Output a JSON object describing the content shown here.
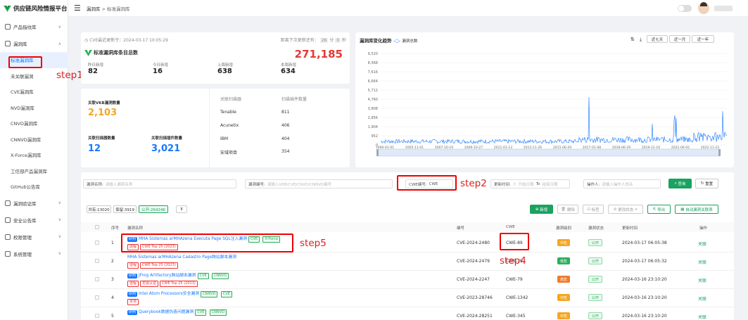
{
  "app": {
    "title": "供应链风险情报平台"
  },
  "breadcrumb": {
    "parent": "漏洞库",
    "sep": ">",
    "current": "标准漏洞库"
  },
  "sidebar": {
    "items": [
      {
        "label": "产品指纹库"
      },
      {
        "label": "漏洞库"
      },
      {
        "label": "漏洞验证库"
      },
      {
        "label": "安全公告库"
      },
      {
        "label": "权限管理"
      },
      {
        "label": "系统管理"
      }
    ],
    "sub": [
      "标准漏洞库",
      "未关联漏洞",
      "CVE漏洞库",
      "NVD漏洞库",
      "CNVD漏洞库",
      "CNNVD漏洞库",
      "X-Force漏洞库",
      "工信部产品漏洞库",
      "GitHub公告库"
    ]
  },
  "summary": {
    "update_label": "CVE最近更新于：",
    "update_time": "2024-03-17 10:05:29",
    "next_label": "距离下次更新还有：",
    "next_h": "26",
    "next_h_unit": "分",
    "next_m": "0",
    "next_m_unit": "秒",
    "title": "标准漏洞库条目总数",
    "total": "271,185",
    "stats": [
      {
        "label": "昨日新增",
        "value": "82"
      },
      {
        "label": "今日新增",
        "value": "16"
      },
      {
        "label": "上周新增",
        "value": "638"
      },
      {
        "label": "本周新增",
        "value": "634"
      }
    ]
  },
  "assoc": {
    "vkb_label": "关联VKB漏洞数量",
    "vkb_value": "2,103",
    "scan_label": "关联扫描器数量",
    "scan_value": "12",
    "plugin_label": "关联扫描插件数量",
    "plugin_value": "3,021",
    "col1": "关联扫描器",
    "col2": "扫描插件数量",
    "rows": [
      {
        "name": "Tenable",
        "count": "811"
      },
      {
        "name": "Acunetix",
        "count": "406"
      },
      {
        "name": "IBM",
        "count": "404"
      },
      {
        "name": "安域项目",
        "count": "354"
      }
    ]
  },
  "trend": {
    "title": "漏洞库变化趋势",
    "legend": "漏洞总数",
    "ranges": [
      "近七天",
      "近一月",
      "近一年"
    ],
    "yticks": [
      "9,520",
      "8,568",
      "7,616",
      "6,664",
      "5,712",
      "4,760",
      "3,808",
      "2,856",
      "1,904",
      "952",
      "0"
    ],
    "xticks": [
      "1900-01-01",
      "2005-11-01",
      "2007-10-19",
      "2009-10-27",
      "2011-01-13",
      "2013-11-26",
      "2015-06-29",
      "2017-01-08",
      "2018-06-29",
      "2019-12-16",
      "2021-06-02",
      "2022-11-23"
    ]
  },
  "filters": {
    "name_label": "漏洞名称:",
    "name_ph": "请输入漏洞名称",
    "id_label": "漏洞编号:",
    "id_ph": "请输入VKB/CVE/CNVD/CNNVD编号",
    "cwe_label": "CWE编号:",
    "cwe_value": "CWE",
    "time_label": "更新时间:",
    "time_start": "开始日期",
    "time_to": "To",
    "time_end": "结束日期",
    "op_label": "操作人:",
    "op_ph": "请输入操作人姓名",
    "search": "查询",
    "reset": "重置"
  },
  "counts": {
    "all": "共有:13020",
    "keep": "保留:3919",
    "public": "公开:264246"
  },
  "actions": {
    "add": "新增",
    "delete": "删除",
    "tag": "标签",
    "status": "更改状态",
    "export": "导出",
    "batch": "自动漏洞关联表"
  },
  "table": {
    "headers": [
      "序号",
      "漏洞名称",
      "编号",
      "CWE",
      "漏洞级别",
      "漏洞状态",
      "更新时间",
      "操作"
    ],
    "rows": [
      {
        "no": "1",
        "research": "研判",
        "name": "MHA Sistemas arMHAzena Executa Page SQL注入漏洞",
        "src": [
          "CVE",
          "X-Force"
        ],
        "tags": [
          "远程",
          "CWE Top 25 (2023)"
        ],
        "id": "CVE-2024-2480",
        "cwe": "CWE-89",
        "level": "中危",
        "level_color": "#f5a623",
        "status": "公开",
        "time": "2024-03-17 06:05:38",
        "op": "关联"
      },
      {
        "no": "2",
        "research": "",
        "name": "MHA Sistemas arMHAzena Cadastro Page跨站脚本漏洞",
        "src": [],
        "tags": [
          "远程",
          "CWE Top 25 (2023)"
        ],
        "id": "CVE-2024-2479",
        "cwe": "CWE-79",
        "level": "低危",
        "level_color": "#2cae5c",
        "status": "公开",
        "time": "2024-03-17 06:05:32",
        "op": "关联"
      },
      {
        "no": "3",
        "research": "研判",
        "name": "JFrog Artifactory跨站脚本漏洞",
        "src": [
          "CVE",
          "CNNVD"
        ],
        "tags": [
          "远程",
          "无需认证",
          "CWE Top 25 (2023)"
        ],
        "id": "CVE-2024-2247",
        "cwe": "CWE-79",
        "level": "高危",
        "level_color": "#f07a2e",
        "status": "公开",
        "time": "2024-03-16 23:10:20",
        "op": "关联"
      },
      {
        "no": "4",
        "research": "研判",
        "name": "Intel Atom Processors安全漏洞",
        "src": [
          "CNNVD",
          "CVE"
        ],
        "tags": [
          "本地"
        ],
        "id": "CVE-2023-28746",
        "cwe": "CWE-1342",
        "level": "中危",
        "level_color": "#f5a623",
        "status": "公开",
        "time": "2024-03-16 23:10:20",
        "op": "关联"
      },
      {
        "no": "5",
        "research": "研判",
        "name": "Querybook数据伪造问题漏洞",
        "src": [
          "CVE",
          "CNNVD"
        ],
        "tags": [],
        "id": "CVE-2024-28251",
        "cwe": "CWE-345",
        "level": "中危",
        "level_color": "#f5a623",
        "status": "公开",
        "time": "2024-03-16 23:10:20",
        "op": "关联"
      }
    ]
  },
  "annotations": {
    "step1": "step1",
    "step2": "step2",
    "step4": "step4",
    "step5": "step5"
  }
}
